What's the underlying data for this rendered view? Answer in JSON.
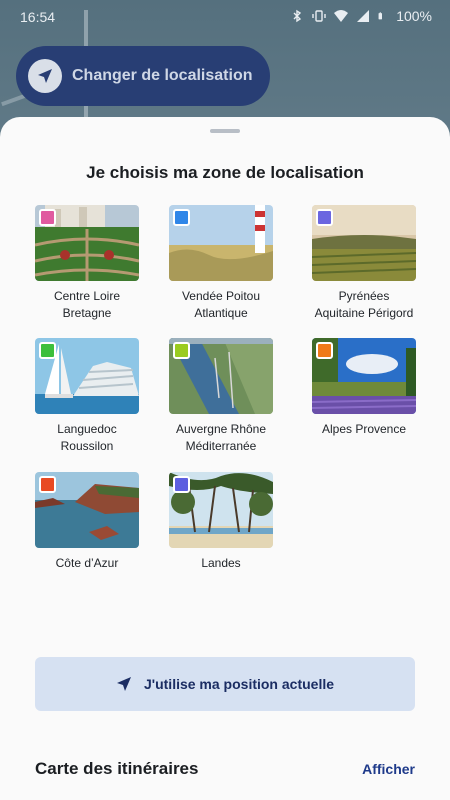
{
  "status_bar": {
    "time": "16:54",
    "battery": "100%",
    "icons": [
      "bluetooth-icon",
      "vibrate-icon",
      "wifi-icon",
      "signal-icon",
      "battery-icon"
    ]
  },
  "background": {
    "change_location_label": "Changer de localisation"
  },
  "sheet": {
    "title": "Je choisis ma zone de localisation",
    "zones": [
      {
        "line1": "Centre Loire",
        "line2": "Bretagne",
        "color": "#e05aa0"
      },
      {
        "line1": "Vendée Poitou",
        "line2": "Atlantique",
        "color": "#2f86e8"
      },
      {
        "line1": "Pyrénées",
        "line2": "Aquitaine Périgord",
        "color": "#6b66e0"
      },
      {
        "line1": "Languedoc",
        "line2": "Roussilon",
        "color": "#3cbf3c"
      },
      {
        "line1": "Auvergne Rhône",
        "line2": "Méditerranée",
        "color": "#9acb20"
      },
      {
        "line1": "Alpes Provence",
        "line2": "",
        "color": "#f07a18"
      },
      {
        "line1": "Côte d’Azur",
        "line2": "",
        "color": "#e84a22"
      },
      {
        "line1": "Landes",
        "line2": "",
        "color": "#5d5fe0"
      }
    ],
    "use_position_label": "J'utilise ma position actuelle",
    "map_section_title": "Carte des itinéraires",
    "map_section_link": "Afficher"
  }
}
